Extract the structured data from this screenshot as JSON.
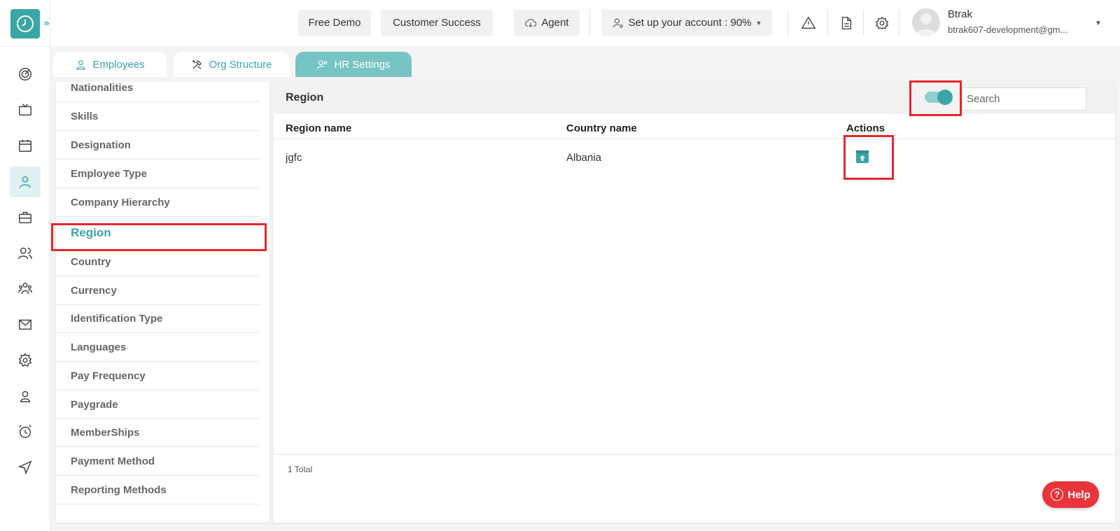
{
  "header": {
    "buttons": {
      "free_demo": "Free Demo",
      "customer_success": "Customer Success",
      "agent": "Agent",
      "setup": "Set up your account : 90%"
    },
    "user": {
      "name": "Btrak",
      "email": "btrak607-development@gm..."
    }
  },
  "tabs": [
    {
      "label": "Employees",
      "icon": "user-icon"
    },
    {
      "label": "Org Structure",
      "icon": "tools-icon"
    },
    {
      "label": "HR Settings",
      "icon": "users-settings-icon"
    }
  ],
  "menu": {
    "items": [
      "Nationalities",
      "Skills",
      "Designation",
      "Employee Type",
      "Company Hierarchy",
      "Region",
      "Country",
      "Currency",
      "Identification Type",
      "Languages",
      "Pay Frequency",
      "Paygrade",
      "MemberShips",
      "Payment Method",
      "Reporting Methods"
    ],
    "active": "Region"
  },
  "panel": {
    "title": "Region",
    "toggle_on": true,
    "search_placeholder": "Search",
    "columns": [
      "Region name",
      "Country name",
      "Actions"
    ],
    "rows": [
      {
        "region": "jgfc",
        "country": "Albania",
        "action_icon": "unarchive-icon"
      }
    ],
    "total": "1 Total"
  },
  "help": {
    "label": "Help"
  },
  "colors": {
    "accent": "#3aa6a6",
    "tab_active": "#76c4c4",
    "annotation": "#e8262b",
    "help": "#e8343a"
  }
}
